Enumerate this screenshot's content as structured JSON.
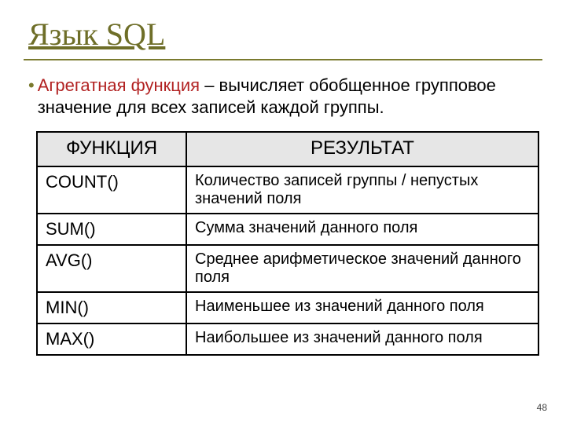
{
  "title": "Язык SQL",
  "bullet": {
    "term": "Агрегатная функция",
    "rest": " – вычисляет обобщенное групповое значение для всех записей каждой группы."
  },
  "table": {
    "headers": {
      "func": "ФУНКЦИЯ",
      "result": "РЕЗУЛЬТАТ"
    },
    "rows": [
      {
        "fn": "COUNT()",
        "desc": "Количество записей группы / непустых значений поля"
      },
      {
        "fn": "SUM()",
        "desc": "Сумма значений данного поля"
      },
      {
        "fn": "AVG()",
        "desc": "Среднее арифметическое значений данного поля"
      },
      {
        "fn": "MIN()",
        "desc": "Наименьшее из значений данного поля"
      },
      {
        "fn": "MAX()",
        "desc": "Наибольшее из значений данного поля"
      }
    ]
  },
  "slide_number": "48"
}
